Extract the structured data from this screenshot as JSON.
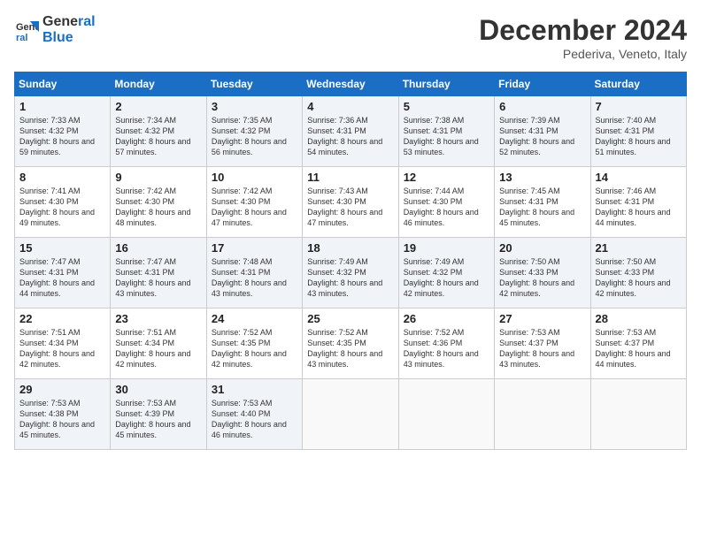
{
  "header": {
    "logo_line1": "General",
    "logo_line2": "Blue",
    "month": "December 2024",
    "location": "Pederiva, Veneto, Italy"
  },
  "days_of_week": [
    "Sunday",
    "Monday",
    "Tuesday",
    "Wednesday",
    "Thursday",
    "Friday",
    "Saturday"
  ],
  "weeks": [
    [
      {
        "day": "1",
        "sunrise": "7:33 AM",
        "sunset": "4:32 PM",
        "daylight": "8 hours and 59 minutes."
      },
      {
        "day": "2",
        "sunrise": "7:34 AM",
        "sunset": "4:32 PM",
        "daylight": "8 hours and 57 minutes."
      },
      {
        "day": "3",
        "sunrise": "7:35 AM",
        "sunset": "4:32 PM",
        "daylight": "8 hours and 56 minutes."
      },
      {
        "day": "4",
        "sunrise": "7:36 AM",
        "sunset": "4:31 PM",
        "daylight": "8 hours and 54 minutes."
      },
      {
        "day": "5",
        "sunrise": "7:38 AM",
        "sunset": "4:31 PM",
        "daylight": "8 hours and 53 minutes."
      },
      {
        "day": "6",
        "sunrise": "7:39 AM",
        "sunset": "4:31 PM",
        "daylight": "8 hours and 52 minutes."
      },
      {
        "day": "7",
        "sunrise": "7:40 AM",
        "sunset": "4:31 PM",
        "daylight": "8 hours and 51 minutes."
      }
    ],
    [
      {
        "day": "8",
        "sunrise": "7:41 AM",
        "sunset": "4:30 PM",
        "daylight": "8 hours and 49 minutes."
      },
      {
        "day": "9",
        "sunrise": "7:42 AM",
        "sunset": "4:30 PM",
        "daylight": "8 hours and 48 minutes."
      },
      {
        "day": "10",
        "sunrise": "7:42 AM",
        "sunset": "4:30 PM",
        "daylight": "8 hours and 47 minutes."
      },
      {
        "day": "11",
        "sunrise": "7:43 AM",
        "sunset": "4:30 PM",
        "daylight": "8 hours and 47 minutes."
      },
      {
        "day": "12",
        "sunrise": "7:44 AM",
        "sunset": "4:30 PM",
        "daylight": "8 hours and 46 minutes."
      },
      {
        "day": "13",
        "sunrise": "7:45 AM",
        "sunset": "4:31 PM",
        "daylight": "8 hours and 45 minutes."
      },
      {
        "day": "14",
        "sunrise": "7:46 AM",
        "sunset": "4:31 PM",
        "daylight": "8 hours and 44 minutes."
      }
    ],
    [
      {
        "day": "15",
        "sunrise": "7:47 AM",
        "sunset": "4:31 PM",
        "daylight": "8 hours and 44 minutes."
      },
      {
        "day": "16",
        "sunrise": "7:47 AM",
        "sunset": "4:31 PM",
        "daylight": "8 hours and 43 minutes."
      },
      {
        "day": "17",
        "sunrise": "7:48 AM",
        "sunset": "4:31 PM",
        "daylight": "8 hours and 43 minutes."
      },
      {
        "day": "18",
        "sunrise": "7:49 AM",
        "sunset": "4:32 PM",
        "daylight": "8 hours and 43 minutes."
      },
      {
        "day": "19",
        "sunrise": "7:49 AM",
        "sunset": "4:32 PM",
        "daylight": "8 hours and 42 minutes."
      },
      {
        "day": "20",
        "sunrise": "7:50 AM",
        "sunset": "4:33 PM",
        "daylight": "8 hours and 42 minutes."
      },
      {
        "day": "21",
        "sunrise": "7:50 AM",
        "sunset": "4:33 PM",
        "daylight": "8 hours and 42 minutes."
      }
    ],
    [
      {
        "day": "22",
        "sunrise": "7:51 AM",
        "sunset": "4:34 PM",
        "daylight": "8 hours and 42 minutes."
      },
      {
        "day": "23",
        "sunrise": "7:51 AM",
        "sunset": "4:34 PM",
        "daylight": "8 hours and 42 minutes."
      },
      {
        "day": "24",
        "sunrise": "7:52 AM",
        "sunset": "4:35 PM",
        "daylight": "8 hours and 42 minutes."
      },
      {
        "day": "25",
        "sunrise": "7:52 AM",
        "sunset": "4:35 PM",
        "daylight": "8 hours and 43 minutes."
      },
      {
        "day": "26",
        "sunrise": "7:52 AM",
        "sunset": "4:36 PM",
        "daylight": "8 hours and 43 minutes."
      },
      {
        "day": "27",
        "sunrise": "7:53 AM",
        "sunset": "4:37 PM",
        "daylight": "8 hours and 43 minutes."
      },
      {
        "day": "28",
        "sunrise": "7:53 AM",
        "sunset": "4:37 PM",
        "daylight": "8 hours and 44 minutes."
      }
    ],
    [
      {
        "day": "29",
        "sunrise": "7:53 AM",
        "sunset": "4:38 PM",
        "daylight": "8 hours and 45 minutes."
      },
      {
        "day": "30",
        "sunrise": "7:53 AM",
        "sunset": "4:39 PM",
        "daylight": "8 hours and 45 minutes."
      },
      {
        "day": "31",
        "sunrise": "7:53 AM",
        "sunset": "4:40 PM",
        "daylight": "8 hours and 46 minutes."
      },
      null,
      null,
      null,
      null
    ]
  ]
}
